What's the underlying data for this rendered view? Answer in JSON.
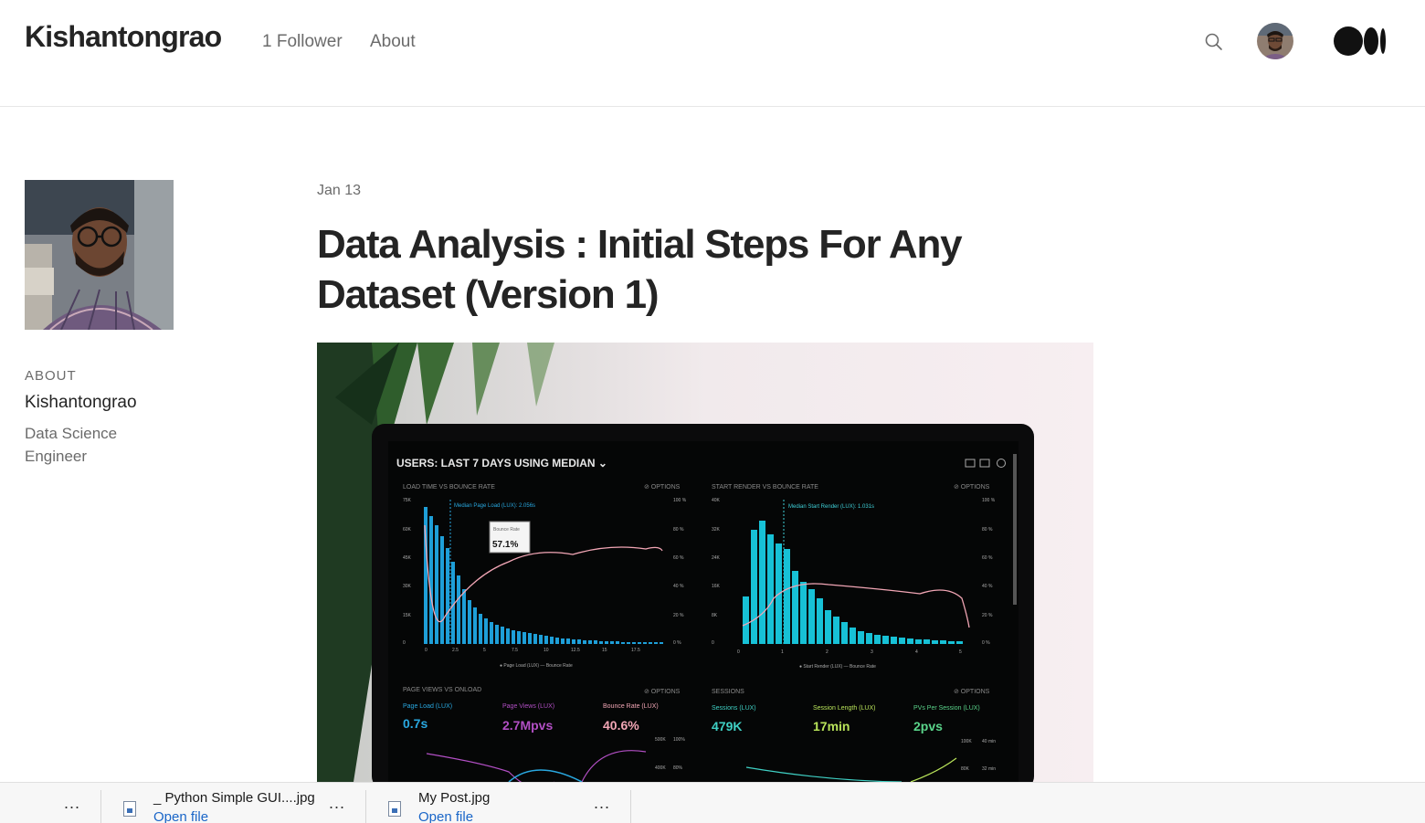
{
  "header": {
    "site_title": "Kishantongrao",
    "followers_label": "1 Follower",
    "about_label": "About",
    "icons": {
      "search": "search-icon",
      "avatar": "user-avatar",
      "logo": "medium-logo"
    }
  },
  "sidebar": {
    "about_heading": "ABOUT",
    "name": "Kishantongrao",
    "bio": "Data Science Engineer"
  },
  "post": {
    "date": "Jan 13",
    "title": "Data Analysis : Initial Steps For Any Dataset (Version 1)"
  },
  "hero_image": {
    "dashboard_title": "USERS: LAST 7 DAYS USING MEDIAN",
    "panel_left_title": "LOAD TIME VS BOUNCE RATE",
    "panel_right_title": "START RENDER VS BOUNCE RATE",
    "options_label": "OPTIONS",
    "median_left": "Median Page Load (LUX): 2.056s",
    "median_right": "Median Start Render (LUX): 1.031s",
    "tooltip_title": "Bounce Rate",
    "tooltip_value": "57.1%",
    "legend_left_a": "Page Load (LUX)",
    "legend_left_b": "Bounce Rate",
    "legend_right_a": "Start Render (LUX)",
    "legend_right_b": "Bounce Rate",
    "y_left": [
      "75K",
      "60K",
      "45K",
      "30K",
      "15K",
      "0"
    ],
    "y_right": [
      "40K",
      "32K",
      "24K",
      "16K",
      "8K",
      "0"
    ],
    "pct": [
      "100 %",
      "80 %",
      "60 %",
      "40 %",
      "20 %",
      "0 %"
    ],
    "x_left": [
      "0",
      "2.5",
      "5",
      "7.5",
      "10",
      "12.5",
      "15",
      "17.5"
    ],
    "x_right": [
      "0",
      "1",
      "2",
      "3",
      "4",
      "5"
    ],
    "bottom_left_title": "PAGE VIEWS VS ONLOAD",
    "bottom_right_title": "SESSIONS",
    "kpis": [
      {
        "label": "Page Load (LUX)",
        "value": "0.7s",
        "color": "#29a8e0"
      },
      {
        "label": "Page Views (LUX)",
        "value": "2.7Mpvs",
        "color": "#b24fc4"
      },
      {
        "label": "Bounce Rate (LUX)",
        "value": "40.6%",
        "color": "#f2a6b5"
      },
      {
        "label": "Sessions (LUX)",
        "value": "479K",
        "color": "#3fd0c4"
      },
      {
        "label": "Session Length (LUX)",
        "value": "17min",
        "color": "#b9e45a"
      },
      {
        "label": "PVs Per Session (LUX)",
        "value": "2pvs",
        "color": "#5ad48a"
      }
    ]
  },
  "downloads": {
    "items": [
      {
        "filename": "_ Python Simple GUI....jpg",
        "action": "Open file"
      },
      {
        "filename": "My Post.jpg",
        "action": "Open file"
      }
    ],
    "more_label": "..."
  },
  "colors": {
    "accent_blue": "#1a66c8",
    "text": "#242424",
    "muted": "#6b6b6b"
  }
}
